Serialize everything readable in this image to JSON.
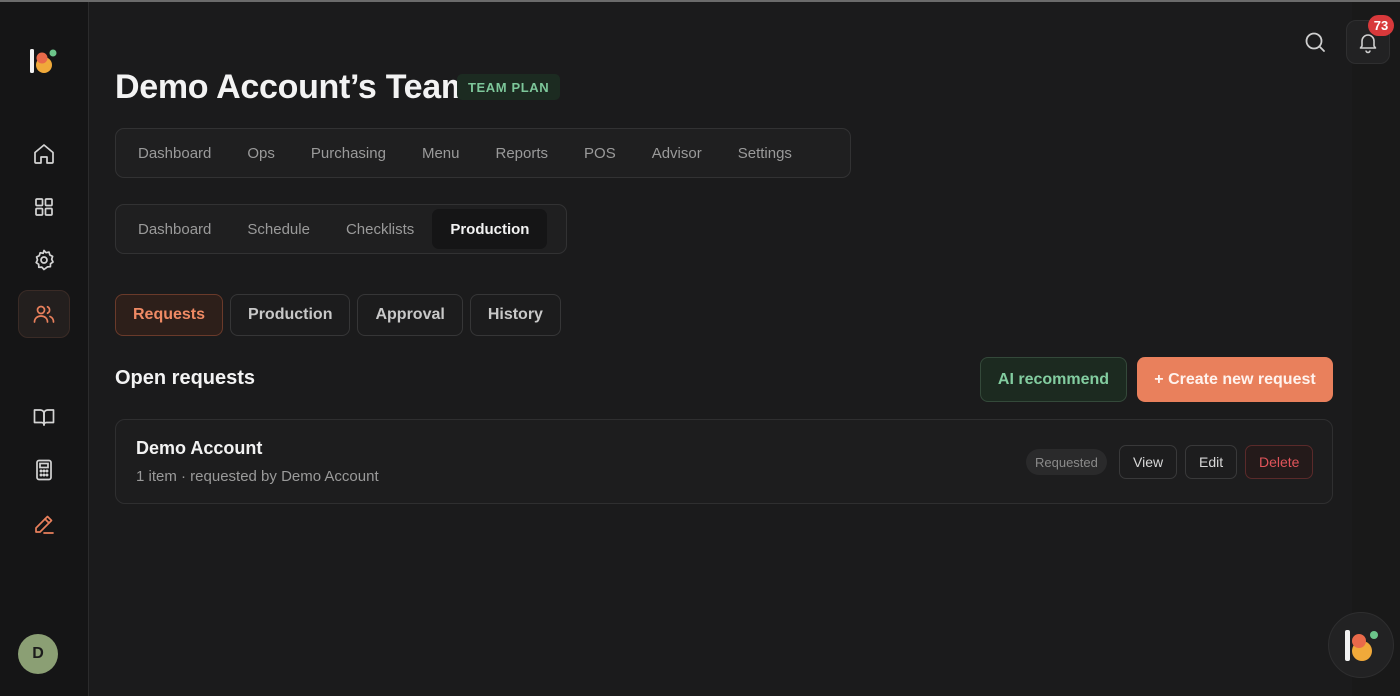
{
  "header": {
    "title": "Demo Account’s Team",
    "plan_badge": "TEAM PLAN",
    "notification_count": "73"
  },
  "main_tabs": [
    "Dashboard",
    "Ops",
    "Purchasing",
    "Menu",
    "Reports",
    "POS",
    "Advisor",
    "Settings"
  ],
  "sub_tabs": [
    "Dashboard",
    "Schedule",
    "Checklists",
    "Production"
  ],
  "sub_tabs_selected": "Production",
  "pill_tabs": [
    "Requests",
    "Production",
    "Approval",
    "History"
  ],
  "pill_tabs_selected": "Requests",
  "section": {
    "title": "Open requests",
    "ai_button": "AI recommend",
    "create_button": "+ Create new request"
  },
  "request": {
    "title": "Demo Account",
    "subtitle": "1 item · requested by Demo Account",
    "status": "Requested",
    "view_label": "View",
    "edit_label": "Edit",
    "delete_label": "Delete"
  },
  "user": {
    "initial": "D"
  },
  "sidebar": {
    "icons": [
      "home-icon",
      "grid-icon",
      "gear-icon",
      "users-icon",
      "book-icon",
      "calculator-icon",
      "pencil-icon"
    ],
    "active": "users-icon"
  },
  "colors": {
    "accent": "#e9805c",
    "success": "#83cda0",
    "danger": "#e0545a",
    "background": "#1b1b1c"
  }
}
